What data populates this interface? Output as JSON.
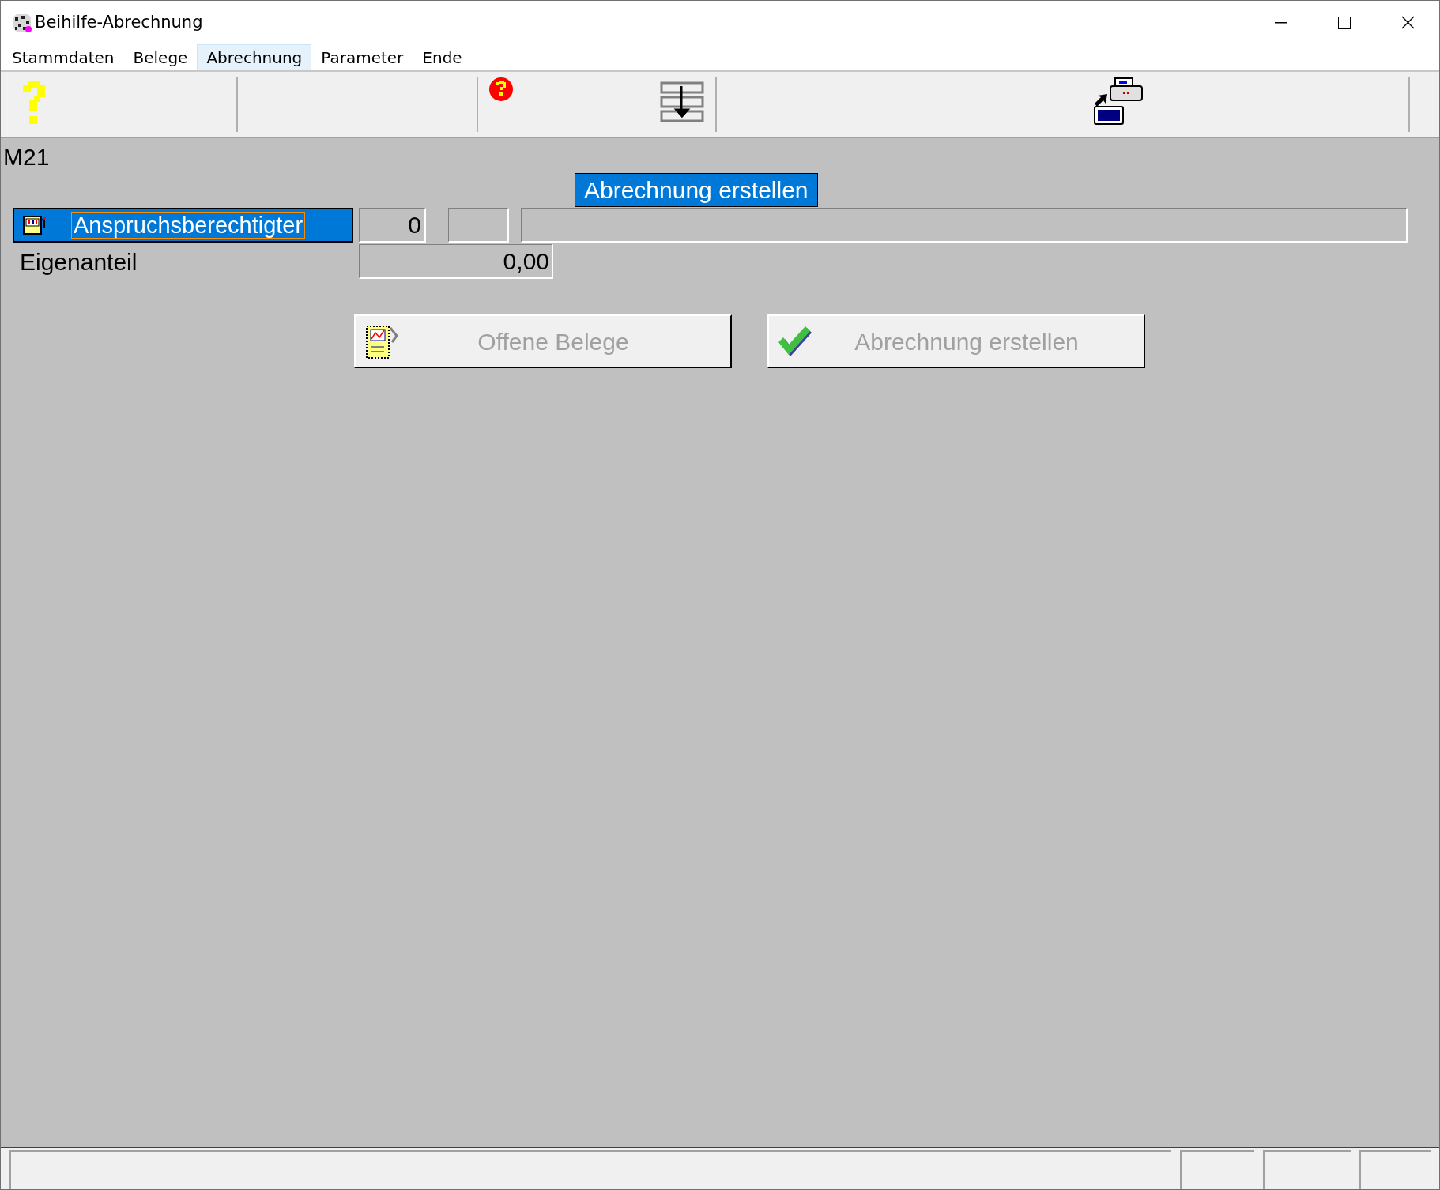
{
  "window": {
    "title": "Beihilfe-Abrechnung"
  },
  "menu": [
    {
      "label": "Stammdaten",
      "selected": false
    },
    {
      "label": "Belege",
      "selected": false
    },
    {
      "label": "Abrechnung",
      "selected": true
    },
    {
      "label": "Parameter",
      "selected": false
    },
    {
      "label": "Ende",
      "selected": false
    }
  ],
  "form": {
    "code": "M21",
    "heading": "Abrechnung erstellen",
    "person": {
      "label": "Anspruchsberechtigter",
      "number": "0"
    },
    "share": {
      "label": "Eigenanteil",
      "value": "0,00"
    }
  },
  "buttons": [
    {
      "kind": "documents",
      "label": "Offene Belege",
      "disabled": true
    },
    {
      "kind": "check",
      "label": "Abrechnung erstellen",
      "disabled": true
    }
  ]
}
